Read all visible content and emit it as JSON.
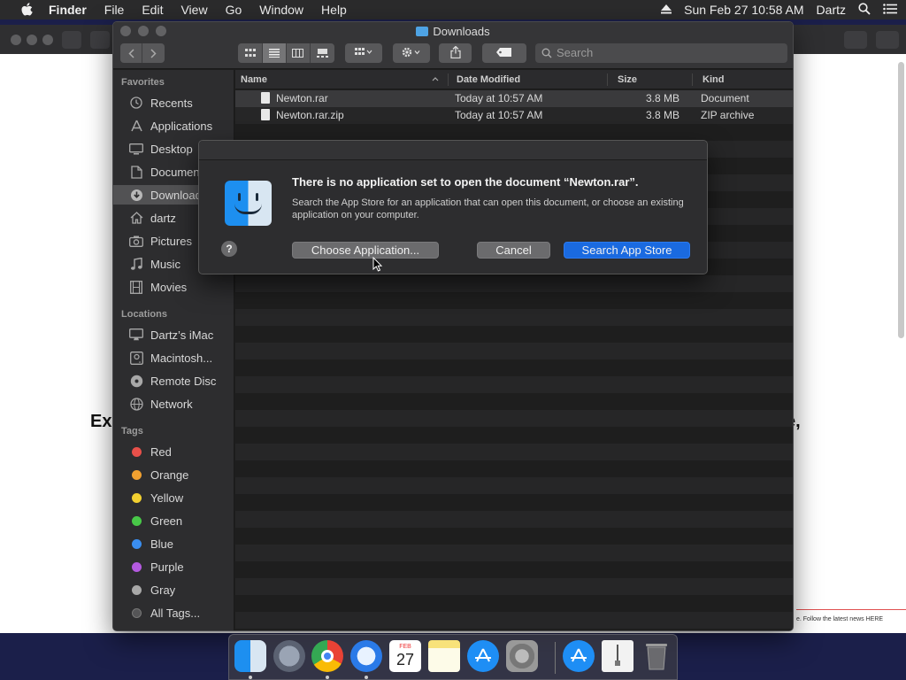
{
  "menubar": {
    "app": "Finder",
    "items": [
      "File",
      "Edit",
      "View",
      "Go",
      "Window",
      "Help"
    ],
    "clock": "Sun Feb 27  10:58 AM",
    "user": "Dartz"
  },
  "background_page": {
    "heading_fragment": "Ex",
    "comma_fragment": "e,",
    "news_text": "e. Follow the latest news HERE"
  },
  "finder": {
    "title": "Downloads",
    "search_placeholder": "Search",
    "sidebar": {
      "favorites_header": "Favorites",
      "favorites": [
        {
          "label": "Recents",
          "icon": "clock-icon"
        },
        {
          "label": "Applications",
          "icon": "applications-icon"
        },
        {
          "label": "Desktop",
          "icon": "desktop-icon"
        },
        {
          "label": "Documents",
          "icon": "documents-icon"
        },
        {
          "label": "Downloads",
          "icon": "downloads-icon",
          "selected": true
        },
        {
          "label": "dartz",
          "icon": "home-icon"
        },
        {
          "label": "Pictures",
          "icon": "camera-icon"
        },
        {
          "label": "Music",
          "icon": "music-icon"
        },
        {
          "label": "Movies",
          "icon": "film-icon"
        }
      ],
      "locations_header": "Locations",
      "locations": [
        {
          "label": "Dartz’s iMac",
          "icon": "imac-icon"
        },
        {
          "label": "Macintosh...",
          "icon": "disk-icon"
        },
        {
          "label": "Remote Disc",
          "icon": "disc-icon"
        },
        {
          "label": "Network",
          "icon": "network-icon"
        }
      ],
      "tags_header": "Tags",
      "tags": [
        {
          "label": "Red",
          "color": "#e8504a"
        },
        {
          "label": "Orange",
          "color": "#f0a030"
        },
        {
          "label": "Yellow",
          "color": "#f2d030"
        },
        {
          "label": "Green",
          "color": "#48c848"
        },
        {
          "label": "Blue",
          "color": "#3a8ef0"
        },
        {
          "label": "Purple",
          "color": "#b45ae0"
        },
        {
          "label": "Gray",
          "color": "#a8a8a8"
        },
        {
          "label": "All Tags...",
          "color": "#555557"
        }
      ]
    },
    "columns": {
      "name": "Name",
      "date": "Date Modified",
      "size": "Size",
      "kind": "Kind"
    },
    "files": [
      {
        "name": "Newton.rar",
        "date": "Today at 10:57 AM",
        "size": "3.8 MB",
        "kind": "Document"
      },
      {
        "name": "Newton.rar.zip",
        "date": "Today at 10:57 AM",
        "size": "3.8 MB",
        "kind": "ZIP archive"
      }
    ]
  },
  "dialog": {
    "title": "There is no application set to open the document “Newton.rar”.",
    "message": "Search the App Store for an application that can open this document, or choose an existing application on your computer.",
    "help_label": "?",
    "choose_label": "Choose Application...",
    "cancel_label": "Cancel",
    "search_label": "Search App Store"
  },
  "dock": {
    "calendar_month": "FEB",
    "calendar_day": "27"
  },
  "colors": {
    "accent": "#1a6ae0",
    "finder_blue": "#1d8ff0"
  }
}
